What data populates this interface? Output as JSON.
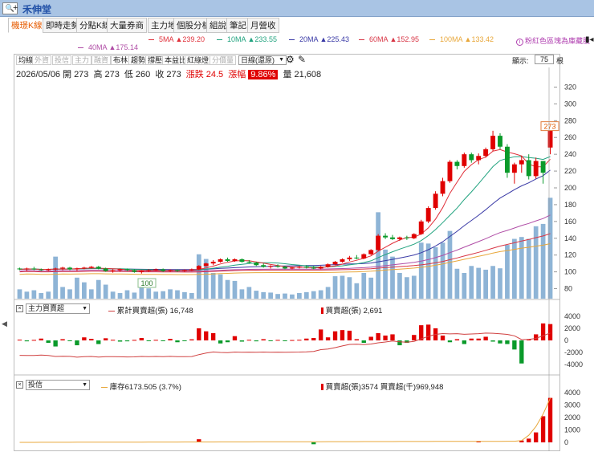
{
  "titlebar": {
    "search_icon": "search-icon",
    "title": "禾伸堂"
  },
  "tabs": [
    {
      "label": "機璟K線",
      "active": true
    },
    {
      "label": "即時走勢",
      "active": false
    },
    {
      "label": "分點K線",
      "active": false
    },
    {
      "label": "大量券商",
      "active": false
    },
    {
      "label": "主力地圖",
      "active": false
    },
    {
      "label": "個股分析",
      "active": false
    },
    {
      "label": "組說",
      "active": false
    },
    {
      "label": "筆記",
      "active": false
    },
    {
      "label": "月營收",
      "active": false
    }
  ],
  "ma_legend": [
    {
      "label": "5MA",
      "value": "▲239.20",
      "color": "#e0303a"
    },
    {
      "label": "10MA",
      "value": "▲233.55",
      "color": "#21a37f"
    },
    {
      "label": "20MA",
      "value": "▲225.43",
      "color": "#3a3aa6"
    },
    {
      "label": "60MA",
      "value": "▲152.95",
      "color": "#d83545"
    },
    {
      "label": "100MA",
      "value": "▲133.42",
      "color": "#e8a73a"
    },
    {
      "label": "40MA",
      "value": "▲175.14",
      "color": "#b04da6"
    }
  ],
  "hint": "粉紅色區塊為庫藏股",
  "toolbar": {
    "buttons": [
      {
        "label": "均線",
        "dim": false
      },
      {
        "label": "外資",
        "dim": true
      },
      {
        "label": "投信",
        "dim": true
      },
      {
        "label": "主力",
        "dim": true
      },
      {
        "label": "融資",
        "dim": true
      },
      {
        "label": "布林",
        "dim": false
      },
      {
        "label": "趨勢",
        "dim": false
      },
      {
        "label": "撐壓",
        "dim": false
      },
      {
        "label": "本益比",
        "dim": false
      },
      {
        "label": "紅綠燈",
        "dim": false
      },
      {
        "label": "分價量",
        "dim": true
      }
    ],
    "period_select": "日線(還原)",
    "display_label": "顯示:",
    "display_value": "75",
    "display_unit": "根"
  },
  "ohlc": {
    "date": "2026/05/06",
    "open_label": "開",
    "open": "273",
    "high_label": "高",
    "high": "273",
    "low_label": "低",
    "low": "260",
    "close_label": "收",
    "close": "273",
    "change_label": "漲跌",
    "change": "24.5",
    "pct_label": "漲幅",
    "pct": "9.86%",
    "vol_label": "量",
    "vol": "21,608"
  },
  "price_axis": {
    "ticks": [
      "320",
      "300",
      "280",
      "260",
      "240",
      "220",
      "200",
      "180",
      "160",
      "140",
      "120",
      "100",
      "80"
    ],
    "last_price": "273",
    "low_marker": "100"
  },
  "panel2": {
    "select": "主力買賣超",
    "series1_label": "累計買賣超(張)",
    "series1_value": "16,748",
    "series2_label": "買賣超(張)",
    "series2_value": "2,691",
    "ticks": [
      "4000",
      "2000",
      "0",
      "-2000",
      "-4000"
    ]
  },
  "panel3": {
    "select": "投信",
    "series1_label": "庫存6173.505 (3.7%)",
    "series2_label": "買賣超(張)3574 買賣超(千)969,948",
    "ticks": [
      "4000",
      "3000",
      "2000",
      "1000",
      "0"
    ]
  },
  "colors": {
    "up": "#e00000",
    "down": "#0a9a2a",
    "vol": "#8eb4d6",
    "ma5": "#e0303a",
    "ma10": "#21a37f",
    "ma20": "#3a3aa6",
    "ma40": "#b04da6",
    "ma60": "#d83545",
    "ma100": "#e8a73a"
  },
  "chart_data": {
    "type": "candlestick",
    "ylim": [
      70,
      330
    ],
    "candles": [
      [
        104,
        105,
        102,
        103
      ],
      [
        103,
        105,
        101,
        104
      ],
      [
        104,
        106,
        102,
        103
      ],
      [
        103,
        104,
        101,
        102
      ],
      [
        102,
        104,
        101,
        103
      ],
      [
        103,
        105,
        101,
        104
      ],
      [
        104,
        106,
        102,
        105
      ],
      [
        105,
        106,
        102,
        103
      ],
      [
        103,
        105,
        101,
        104
      ],
      [
        104,
        106,
        103,
        105
      ],
      [
        105,
        107,
        104,
        106
      ],
      [
        106,
        107,
        103,
        104
      ],
      [
        104,
        105,
        100,
        101
      ],
      [
        101,
        103,
        99,
        102
      ],
      [
        102,
        104,
        100,
        103
      ],
      [
        103,
        104,
        101,
        102
      ],
      [
        102,
        103,
        99,
        100
      ],
      [
        100,
        102,
        98,
        101
      ],
      [
        101,
        103,
        100,
        102
      ],
      [
        102,
        104,
        101,
        103
      ],
      [
        103,
        104,
        100,
        101
      ],
      [
        101,
        103,
        100,
        102
      ],
      [
        102,
        103,
        100,
        101
      ],
      [
        101,
        103,
        100,
        102
      ],
      [
        102,
        104,
        101,
        103
      ],
      [
        103,
        108,
        102,
        107
      ],
      [
        107,
        111,
        106,
        110
      ],
      [
        110,
        114,
        108,
        112
      ],
      [
        112,
        116,
        111,
        115
      ],
      [
        115,
        117,
        112,
        113
      ],
      [
        113,
        116,
        112,
        115
      ],
      [
        115,
        116,
        111,
        112
      ],
      [
        112,
        114,
        110,
        111
      ],
      [
        111,
        112,
        107,
        108
      ],
      [
        108,
        110,
        105,
        106
      ],
      [
        106,
        108,
        104,
        107
      ],
      [
        107,
        109,
        105,
        106
      ],
      [
        106,
        107,
        103,
        104
      ],
      [
        104,
        106,
        103,
        105
      ],
      [
        105,
        107,
        104,
        106
      ],
      [
        106,
        108,
        104,
        105
      ],
      [
        105,
        107,
        103,
        104
      ],
      [
        104,
        107,
        103,
        106
      ],
      [
        106,
        110,
        105,
        109
      ],
      [
        109,
        113,
        108,
        112
      ],
      [
        112,
        116,
        111,
        115
      ],
      [
        115,
        119,
        113,
        117
      ],
      [
        117,
        120,
        115,
        116
      ],
      [
        116,
        122,
        115,
        121
      ],
      [
        121,
        127,
        120,
        126
      ],
      [
        126,
        145,
        125,
        143
      ],
      [
        143,
        146,
        139,
        141
      ],
      [
        141,
        144,
        138,
        139
      ],
      [
        139,
        142,
        137,
        141
      ],
      [
        141,
        143,
        138,
        140
      ],
      [
        140,
        146,
        139,
        145
      ],
      [
        145,
        162,
        144,
        160
      ],
      [
        160,
        178,
        158,
        176
      ],
      [
        176,
        196,
        174,
        193
      ],
      [
        193,
        212,
        190,
        208
      ],
      [
        208,
        233,
        206,
        231
      ],
      [
        231,
        233,
        222,
        226
      ],
      [
        226,
        242,
        224,
        240
      ],
      [
        240,
        242,
        230,
        233
      ],
      [
        233,
        241,
        228,
        238
      ],
      [
        238,
        248,
        236,
        246
      ],
      [
        246,
        268,
        244,
        262
      ],
      [
        262,
        265,
        246,
        249
      ],
      [
        249,
        252,
        212,
        218
      ],
      [
        218,
        230,
        205,
        228
      ],
      [
        228,
        238,
        218,
        233
      ],
      [
        233,
        240,
        210,
        214
      ],
      [
        214,
        236,
        211,
        232
      ],
      [
        232,
        232,
        205,
        218
      ],
      [
        248,
        273,
        240,
        273
      ]
    ],
    "volume_max": 22000,
    "volume_points": [
      2000,
      1500,
      1800,
      1200,
      1500,
      9000,
      2500,
      2000,
      4500,
      3500,
      2000,
      4000,
      3000,
      1500,
      1200,
      1800,
      1300,
      2400,
      2200,
      1500,
      1600,
      2000,
      1800,
      1400,
      1200,
      9500,
      8500,
      5500,
      5200,
      4000,
      3800,
      2000,
      2500,
      1700,
      1400,
      1300,
      1000,
      1100,
      900,
      1200,
      1400,
      1600,
      1800,
      2500,
      4800,
      4900,
      4600,
      3300,
      5500,
      4500,
      18500,
      10500,
      9000,
      5500,
      4600,
      4900,
      12000,
      11800,
      11000,
      12000,
      14500,
      6400,
      5500,
      7000,
      6600,
      6200,
      7000,
      6500,
      11500,
      12800,
      13200,
      12800,
      15500,
      16000,
      21600
    ]
  }
}
